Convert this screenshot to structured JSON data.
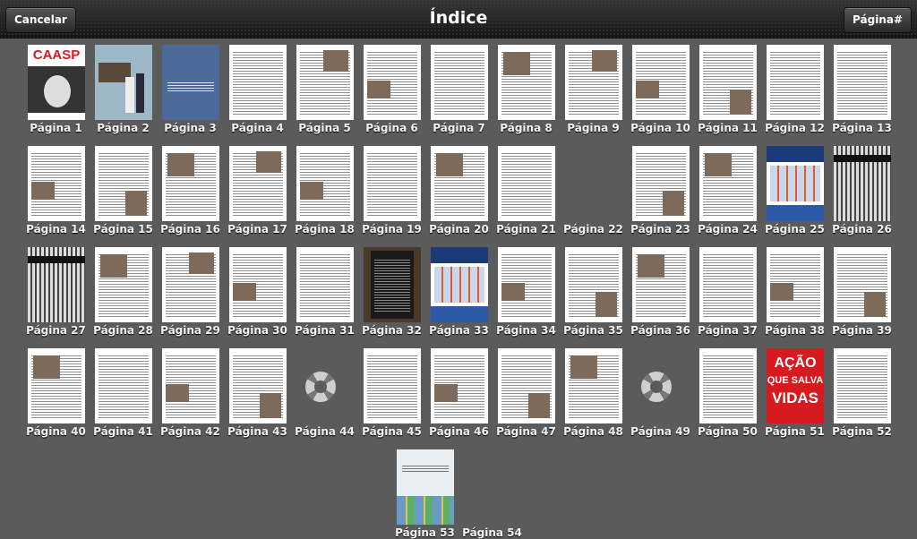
{
  "header": {
    "title": "Índice",
    "cancel_label": "Cancelar",
    "page_label": "Página#"
  },
  "pages": [
    {
      "label": "Página 1",
      "kind": "cover"
    },
    {
      "label": "Página 2",
      "kind": "photo-cover"
    },
    {
      "label": "Página 3",
      "kind": "blue"
    },
    {
      "label": "Página 4",
      "kind": "text"
    },
    {
      "label": "Página 5",
      "kind": "text-photo"
    },
    {
      "label": "Página 6",
      "kind": "text-photo"
    },
    {
      "label": "Página 7",
      "kind": "text"
    },
    {
      "label": "Página 8",
      "kind": "text-photo"
    },
    {
      "label": "Página 9",
      "kind": "text-photo"
    },
    {
      "label": "Página 10",
      "kind": "text-photo"
    },
    {
      "label": "Página 11",
      "kind": "text-photo"
    },
    {
      "label": "Página 12",
      "kind": "text"
    },
    {
      "label": "Página 13",
      "kind": "text"
    },
    {
      "label": "Página 14",
      "kind": "text-photo"
    },
    {
      "label": "Página 15",
      "kind": "text-photo"
    },
    {
      "label": "Página 16",
      "kind": "text-photo"
    },
    {
      "label": "Página 17",
      "kind": "text-photo"
    },
    {
      "label": "Página 18",
      "kind": "text-photo"
    },
    {
      "label": "Página 19",
      "kind": "text"
    },
    {
      "label": "Página 20",
      "kind": "text-photo"
    },
    {
      "label": "Página 21",
      "kind": "text"
    },
    {
      "label": "Página 22",
      "kind": "empty"
    },
    {
      "label": "Página 23",
      "kind": "text-photo"
    },
    {
      "label": "Página 24",
      "kind": "text-photo"
    },
    {
      "label": "Página 25",
      "kind": "ad"
    },
    {
      "label": "Página 26",
      "kind": "dark"
    },
    {
      "label": "Página 27",
      "kind": "dark"
    },
    {
      "label": "Página 28",
      "kind": "text-photo"
    },
    {
      "label": "Página 29",
      "kind": "text-photo"
    },
    {
      "label": "Página 30",
      "kind": "text-photo"
    },
    {
      "label": "Página 31",
      "kind": "text"
    },
    {
      "label": "Página 32",
      "kind": "darkbox"
    },
    {
      "label": "Página 33",
      "kind": "ad"
    },
    {
      "label": "Página 34",
      "kind": "text-photo"
    },
    {
      "label": "Página 35",
      "kind": "text-photo"
    },
    {
      "label": "Página 36",
      "kind": "text-photo"
    },
    {
      "label": "Página 37",
      "kind": "text"
    },
    {
      "label": "Página 38",
      "kind": "text-photo"
    },
    {
      "label": "Página 39",
      "kind": "text-photo"
    },
    {
      "label": "Página 40",
      "kind": "text-photo"
    },
    {
      "label": "Página 41",
      "kind": "text"
    },
    {
      "label": "Página 42",
      "kind": "text-photo"
    },
    {
      "label": "Página 43",
      "kind": "text-photo"
    },
    {
      "label": "Página 44",
      "kind": "loading"
    },
    {
      "label": "Página 45",
      "kind": "text"
    },
    {
      "label": "Página 46",
      "kind": "text-photo"
    },
    {
      "label": "Página 47",
      "kind": "text-photo"
    },
    {
      "label": "Página 48",
      "kind": "text-photo"
    },
    {
      "label": "Página 49",
      "kind": "loading"
    },
    {
      "label": "Página 50",
      "kind": "text"
    },
    {
      "label": "Página 51",
      "kind": "red"
    },
    {
      "label": "Página 52",
      "kind": "text"
    },
    {
      "label": "Página 53",
      "kind": "card"
    },
    {
      "label": "Página 54",
      "kind": "empty"
    }
  ],
  "covers": {
    "p1": "CAASP",
    "p51_line1": "AÇÃO",
    "p51_line2": "QUE SALVA",
    "p51_line3": "VIDAS"
  }
}
